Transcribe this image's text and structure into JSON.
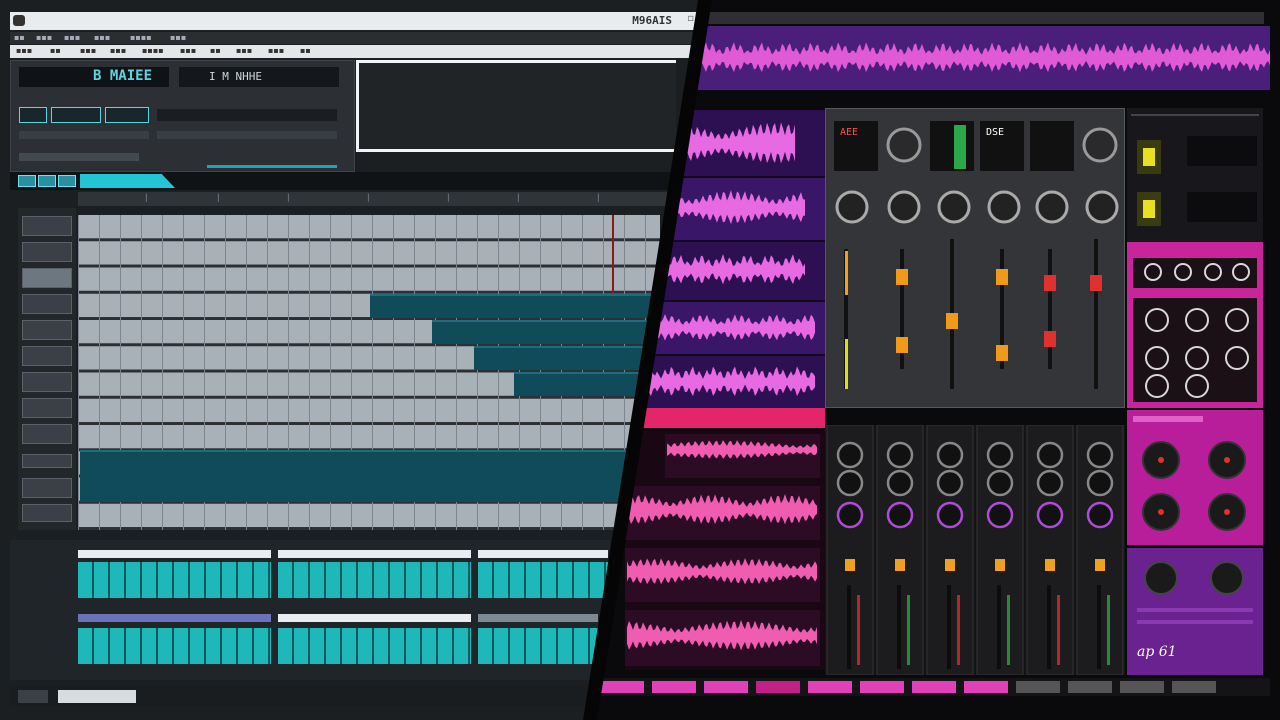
{
  "left_daw": {
    "window_title": "M96AIS",
    "lcd_primary": "B MAIEE",
    "lcd_secondary": "I M NHHE",
    "track_labels": [
      "",
      "",
      "",
      "",
      "",
      "",
      "",
      "",
      "",
      "",
      ""
    ],
    "lower_row_labels": [
      "",
      "",
      ""
    ],
    "status_text": ""
  },
  "right_mixer": {
    "display_top": [
      "AEE",
      "",
      "DSE"
    ],
    "fx_readouts": [
      "",
      "",
      ""
    ],
    "purple_caption": "ap 61",
    "pink_header": ""
  },
  "colors": {
    "daw_bg": "#1c1f22",
    "grid_cell": "#a8b0b8",
    "clip_teal": "#0f4b58",
    "accent_cyan": "#23c4d6",
    "wave_purple": "#4a1f7a",
    "wave_pink": "#e05ad8",
    "hot_pink": "#e5256a",
    "magenta_panel": "#b81e9a",
    "purple_panel": "#6a2290"
  }
}
